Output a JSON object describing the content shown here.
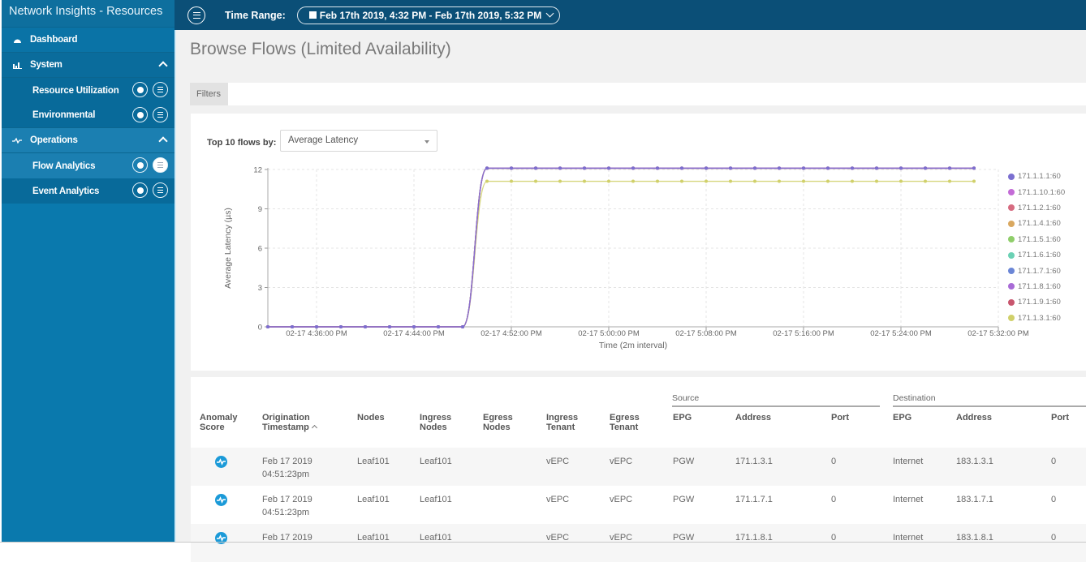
{
  "app": {
    "title": "Network Insights - Resources"
  },
  "sidebar": {
    "items": [
      {
        "label": "Dashboard",
        "icon": "dashboard-icon"
      },
      {
        "label": "System",
        "icon": "bar-chart-icon",
        "expanded": true
      },
      {
        "label": "Resource Utilization"
      },
      {
        "label": "Environmental"
      },
      {
        "label": "Operations",
        "icon": "pulse-icon",
        "expanded": true
      },
      {
        "label": "Flow Analytics",
        "active": true
      },
      {
        "label": "Event Analytics"
      }
    ]
  },
  "topbar": {
    "time_range_label": "Time Range:",
    "time_range_value": "Feb 17th 2019, 4:32 PM - Feb 17th 2019, 5:32 PM"
  },
  "page": {
    "title": "Browse Flows (Limited Availability)",
    "filters_tab": "Filters"
  },
  "selector": {
    "label": "Top 10 flows by:",
    "value": "Average Latency"
  },
  "chart_data": {
    "type": "line",
    "title": "",
    "xlabel": "Time (2m interval)",
    "ylabel": "Average Latency (µs)",
    "ylim": [
      0,
      12
    ],
    "yticks": [
      "0",
      "3",
      "6",
      "9",
      "12"
    ],
    "x_tick_labels": [
      "02-17 4:36:00 PM",
      "02-17 4:44:00 PM",
      "02-17 4:52:00 PM",
      "02-17 5:00:00 PM",
      "02-17 5:08:00 PM",
      "02-17 5:16:00 PM",
      "02-17 5:24:00 PM",
      "02-17 5:32:00 PM"
    ],
    "x_minutes": [
      0,
      2,
      4,
      6,
      8,
      10,
      12,
      14,
      16,
      18,
      20,
      22,
      24,
      26,
      28,
      30,
      32,
      34,
      36,
      38,
      40,
      42,
      44,
      46,
      48,
      50,
      52,
      54,
      56,
      58,
      60
    ],
    "x_start_label": "02-17 4:32:00 PM",
    "grid": true,
    "legend_position": "right",
    "series": [
      {
        "name": "171.1.1.1:60",
        "color": "#7b6fd0",
        "values": [
          0,
          0,
          0,
          0,
          0,
          0,
          0,
          0,
          0,
          12.1,
          12.1,
          12.1,
          12.1,
          12.1,
          12.1,
          12.1,
          12.1,
          12.1,
          12.1,
          12.1,
          12.1,
          12.1,
          12.1,
          12.1,
          12.1,
          12.1,
          12.1,
          12.1,
          12.1,
          12.1
        ]
      },
      {
        "name": "171.1.10.1:60",
        "color": "#c36bd6",
        "values": [
          0,
          0,
          0,
          0,
          0,
          0,
          0,
          0,
          0,
          12.1,
          12.1,
          12.1,
          12.1,
          12.1,
          12.1,
          12.1,
          12.1,
          12.1,
          12.1,
          12.1,
          12.1,
          12.1,
          12.1,
          12.1,
          12.1,
          12.1,
          12.1,
          12.1,
          12.1,
          12.1
        ]
      },
      {
        "name": "171.1.2.1:60",
        "color": "#d66b80",
        "values": [
          0,
          0,
          0,
          0,
          0,
          0,
          0,
          0,
          0,
          12.1,
          12.1,
          12.1,
          12.1,
          12.1,
          12.1,
          12.1,
          12.1,
          12.1,
          12.1,
          12.1,
          12.1,
          12.1,
          12.1,
          12.1,
          12.1,
          12.1,
          12.1,
          12.1,
          12.1,
          12.1
        ]
      },
      {
        "name": "171.1.4.1:60",
        "color": "#d9a860",
        "values": [
          0,
          0,
          0,
          0,
          0,
          0,
          0,
          0,
          0,
          12.1,
          12.1,
          12.1,
          12.1,
          12.1,
          12.1,
          12.1,
          12.1,
          12.1,
          12.1,
          12.1,
          12.1,
          12.1,
          12.1,
          12.1,
          12.1,
          12.1,
          12.1,
          12.1,
          12.1,
          12.1
        ]
      },
      {
        "name": "171.1.5.1:60",
        "color": "#8fce6a",
        "values": [
          0,
          0,
          0,
          0,
          0,
          0,
          0,
          0,
          0,
          12.1,
          12.1,
          12.1,
          12.1,
          12.1,
          12.1,
          12.1,
          12.1,
          12.1,
          12.1,
          12.1,
          12.1,
          12.1,
          12.1,
          12.1,
          12.1,
          12.1,
          12.1,
          12.1,
          12.1,
          12.1
        ]
      },
      {
        "name": "171.1.6.1:60",
        "color": "#6bd1b4",
        "values": [
          0,
          0,
          0,
          0,
          0,
          0,
          0,
          0,
          0,
          12.1,
          12.1,
          12.1,
          12.1,
          12.1,
          12.1,
          12.1,
          12.1,
          12.1,
          12.1,
          12.1,
          12.1,
          12.1,
          12.1,
          12.1,
          12.1,
          12.1,
          12.1,
          12.1,
          12.1,
          12.1
        ]
      },
      {
        "name": "171.1.7.1:60",
        "color": "#6b86d6",
        "values": [
          0,
          0,
          0,
          0,
          0,
          0,
          0,
          0,
          0,
          12.1,
          12.1,
          12.1,
          12.1,
          12.1,
          12.1,
          12.1,
          12.1,
          12.1,
          12.1,
          12.1,
          12.1,
          12.1,
          12.1,
          12.1,
          12.1,
          12.1,
          12.1,
          12.1,
          12.1,
          12.1
        ]
      },
      {
        "name": "171.1.8.1:60",
        "color": "#a86bd6",
        "values": [
          0,
          0,
          0,
          0,
          0,
          0,
          0,
          0,
          0,
          12.1,
          12.1,
          12.1,
          12.1,
          12.1,
          12.1,
          12.1,
          12.1,
          12.1,
          12.1,
          12.1,
          12.1,
          12.1,
          12.1,
          12.1,
          12.1,
          12.1,
          12.1,
          12.1,
          12.1,
          12.1
        ]
      },
      {
        "name": "171.1.9.1:60",
        "color": "#c8566e",
        "values": [
          0,
          0,
          0,
          0,
          0,
          0,
          0,
          0,
          0,
          12.1,
          12.1,
          12.1,
          12.1,
          12.1,
          12.1,
          12.1,
          12.1,
          12.1,
          12.1,
          12.1,
          12.1,
          12.1,
          12.1,
          12.1,
          12.1,
          12.1,
          12.1,
          12.1,
          12.1,
          12.1
        ]
      },
      {
        "name": "171.1.3.1:60",
        "color": "#d0d06a",
        "values": [
          0,
          0,
          0,
          0,
          0,
          0,
          0,
          0,
          0,
          11.1,
          11.1,
          11.1,
          11.1,
          11.1,
          11.1,
          11.1,
          11.1,
          11.1,
          11.1,
          11.1,
          11.1,
          11.1,
          11.1,
          11.1,
          11.1,
          11.1,
          11.1,
          11.1,
          11.1,
          11.1
        ]
      }
    ]
  },
  "table": {
    "group_headers": {
      "source": "Source",
      "destination": "Destination"
    },
    "columns": [
      "Anomaly\nScore",
      "Origination\nTimestamp",
      "Nodes",
      "Ingress\nNodes",
      "Egress\nNodes",
      "Ingress\nTenant",
      "Egress\nTenant",
      "EPG",
      "Address",
      "Port",
      "EPG",
      "Address",
      "Port"
    ],
    "col_head": {
      "anomaly1": "Anomaly",
      "anomaly2": "Score",
      "orig1": "Origination",
      "orig2": "Timestamp",
      "nodes": "Nodes",
      "in_nodes1": "Ingress",
      "in_nodes2": "Nodes",
      "eg_nodes1": "Egress",
      "eg_nodes2": "Nodes",
      "in_ten1": "Ingress",
      "in_ten2": "Tenant",
      "eg_ten1": "Egress",
      "eg_ten2": "Tenant",
      "src_epg": "EPG",
      "src_addr": "Address",
      "src_port": "Port",
      "dst_epg": "EPG",
      "dst_addr": "Address",
      "dst_port": "Port"
    },
    "sort": {
      "column": "Origination Timestamp",
      "direction": "ascending"
    },
    "rows": [
      {
        "anomaly": "pulse-icon",
        "date": "Feb 17 2019",
        "time": "04:51:23pm",
        "nodes": "Leaf101",
        "ingress_nodes": "Leaf101",
        "egress_nodes": "",
        "ingress_tenant": "vEPC",
        "egress_tenant": "vEPC",
        "src_epg": "PGW",
        "src_address": "171.1.3.1",
        "src_port": "0",
        "dst_epg": "Internet",
        "dst_address": "183.1.3.1",
        "dst_port": "0"
      },
      {
        "anomaly": "pulse-icon",
        "date": "Feb 17 2019",
        "time": "04:51:23pm",
        "nodes": "Leaf101",
        "ingress_nodes": "Leaf101",
        "egress_nodes": "",
        "ingress_tenant": "vEPC",
        "egress_tenant": "vEPC",
        "src_epg": "PGW",
        "src_address": "171.1.7.1",
        "src_port": "0",
        "dst_epg": "Internet",
        "dst_address": "183.1.7.1",
        "dst_port": "0"
      },
      {
        "anomaly": "pulse-icon",
        "date": "Feb 17 2019",
        "time": "",
        "nodes": "Leaf101",
        "ingress_nodes": "Leaf101",
        "egress_nodes": "",
        "ingress_tenant": "vEPC",
        "egress_tenant": "vEPC",
        "src_epg": "PGW",
        "src_address": "171.1.8.1",
        "src_port": "0",
        "dst_epg": "Internet",
        "dst_address": "183.1.8.1",
        "dst_port": "0"
      }
    ]
  },
  "colors": {
    "sidebar": "#0a79ad",
    "topbar": "#0b4f77",
    "anomaly_icon": "#1b9ad8"
  }
}
